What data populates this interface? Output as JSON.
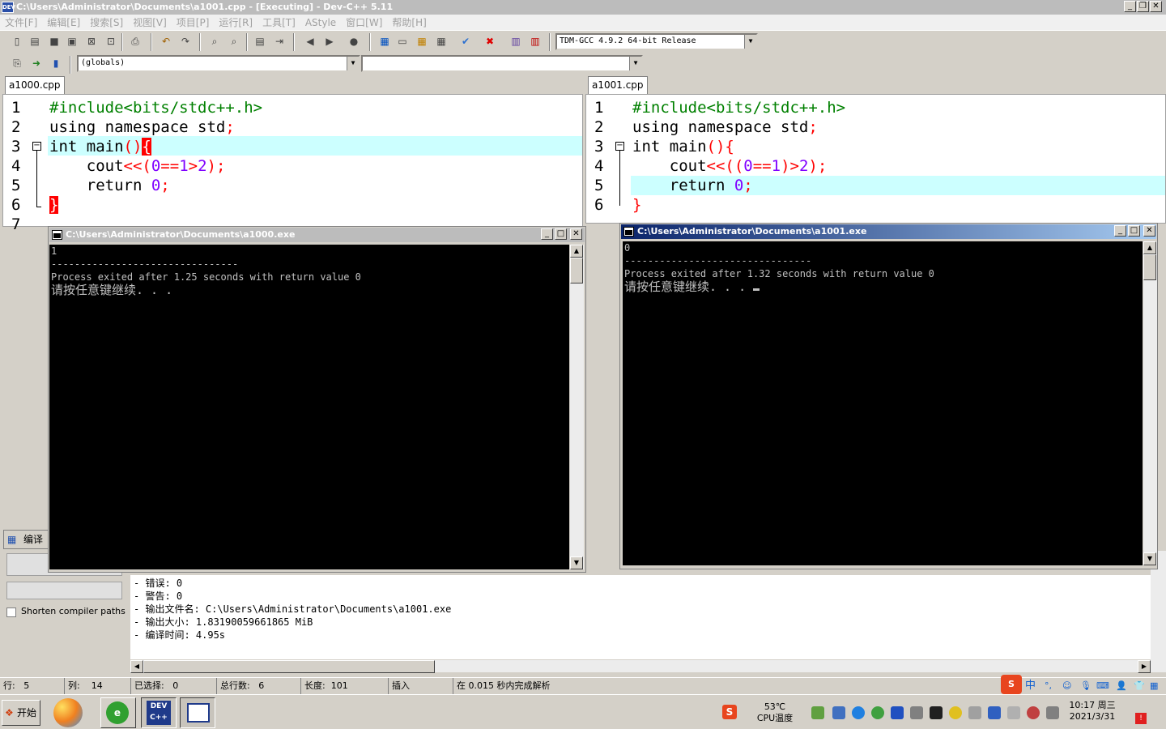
{
  "window": {
    "title": "C:\\Users\\Administrator\\Documents\\a1001.cpp - [Executing] - Dev-C++ 5.11",
    "icon_text": "DEV"
  },
  "menu": [
    "文件[F]",
    "编辑[E]",
    "搜索[S]",
    "视图[V]",
    "项目[P]",
    "运行[R]",
    "工具[T]",
    "AStyle",
    "窗口[W]",
    "帮助[H]"
  ],
  "toolbar": {
    "compiler": "TDM-GCC 4.9.2 64-bit Release",
    "scope": "(globals)",
    "member": ""
  },
  "left_editor": {
    "tab": "a1000.cpp",
    "line_numbers": [
      "1",
      "2",
      "3",
      "4",
      "5",
      "6",
      "7"
    ],
    "lines": {
      "l1": "#include<bits/stdc++.h>",
      "l2a": "using namespace std",
      "l2b": ";",
      "l3a": "int main",
      "l3b": "()",
      "l3c": "{",
      "l4a": "    cout",
      "l4b": "<<(",
      "l4c": "0",
      "l4d": "==",
      "l4e": "1",
      "l4f": ">",
      "l4g": "2",
      "l4h": ");",
      "l5a": "    return ",
      "l5b": "0",
      "l5c": ";",
      "l6": "}"
    }
  },
  "right_editor": {
    "tab": "a1001.cpp",
    "line_numbers": [
      "1",
      "2",
      "3",
      "4",
      "5",
      "6"
    ],
    "lines": {
      "l1": "#include<bits/stdc++.h>",
      "l2a": "using namespace std",
      "l2b": ";",
      "l3a": "int main",
      "l3b": "(){",
      "l4a": "    cout",
      "l4b": "<<((",
      "l4c": "0",
      "l4d": "==",
      "l4e": "1",
      "l4f": ")>",
      "l4g": "2",
      "l4h": ");",
      "l5a": "    return ",
      "l5b": "0",
      "l5c": ";",
      "l6": "}"
    }
  },
  "console_left": {
    "title": "C:\\Users\\Administrator\\Documents\\a1000.exe",
    "line1": "1",
    "line2": "--------------------------------",
    "line3": "Process exited after 1.25 seconds with return value 0",
    "line4": "请按任意键继续. . ."
  },
  "console_right": {
    "title": "C:\\Users\\Administrator\\Documents\\a1001.exe",
    "line1": "0",
    "line2": "--------------------------------",
    "line3": "Process exited after 1.32 seconds with return value 0",
    "line4": "请按任意键继续. . ."
  },
  "bottom_panel": {
    "tab": "编译",
    "shorten_label": "Shorten compiler paths",
    "output": [
      "- 错误: 0",
      "- 警告: 0",
      "- 输出文件名: C:\\Users\\Administrator\\Documents\\a1001.exe",
      "- 输出大小: 1.83190059661865 MiB",
      "- 编译时间: 4.95s"
    ]
  },
  "status": {
    "row_label": "行:",
    "row": "5",
    "col_label": "列:",
    "col": "14",
    "sel_label": "已选择:",
    "sel": "0",
    "total_label": "总行数:",
    "total": "6",
    "len_label": "长度:",
    "len": "101",
    "mode": "插入",
    "parse": "在 0.015 秒内完成解析"
  },
  "taskbar": {
    "start": "开始",
    "temp": "53℃",
    "temp_label": "CPU温度",
    "time": "10:17 周三",
    "date": "2021/3/31",
    "ime": "中"
  }
}
